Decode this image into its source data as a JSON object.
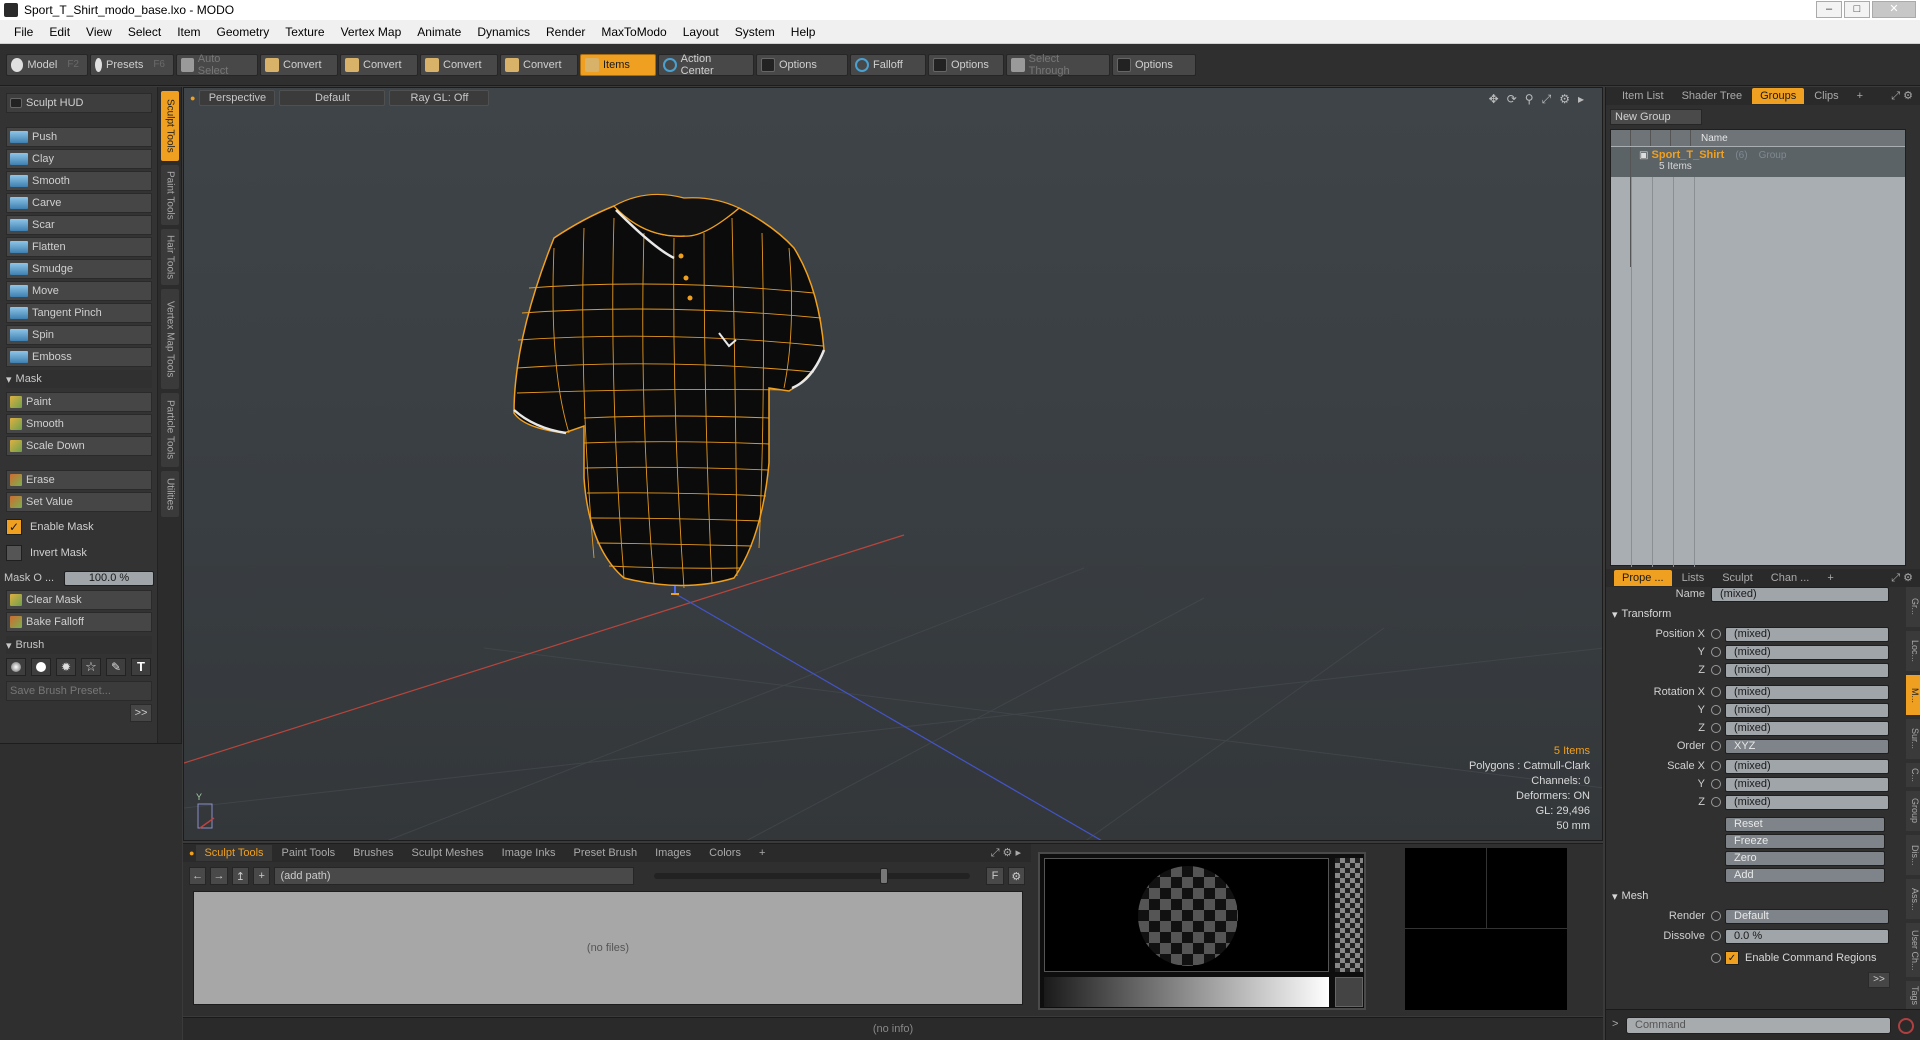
{
  "window": {
    "title": "Sport_T_Shirt_modo_base.lxo - MODO"
  },
  "menubar": [
    "File",
    "Edit",
    "View",
    "Select",
    "Item",
    "Geometry",
    "Texture",
    "Vertex Map",
    "Animate",
    "Dynamics",
    "Render",
    "MaxToModo",
    "Layout",
    "System",
    "Help"
  ],
  "toolbar": {
    "model": "Model",
    "model_key": "F2",
    "presets": "Presets",
    "presets_key": "F6",
    "auto_select": "Auto Select",
    "convert1": "Convert",
    "convert2": "Convert",
    "convert3": "Convert",
    "convert4": "Convert",
    "items": "Items",
    "action_center": "Action Center",
    "options1": "Options",
    "falloff": "Falloff",
    "options2": "Options",
    "select_through": "Select Through",
    "options3": "Options"
  },
  "left_panel": {
    "vtabs": [
      "Sculpt Tools",
      "Paint Tools",
      "Hair Tools",
      "Vertex Map Tools",
      "Particle Tools",
      "Utilities"
    ],
    "hud": "Sculpt HUD",
    "tools": [
      "Push",
      "Clay",
      "Smooth",
      "Carve",
      "Scar",
      "Flatten",
      "Smudge",
      "Move",
      "Tangent Pinch",
      "Spin",
      "Emboss"
    ],
    "mask_header": "Mask",
    "mask_tools": [
      "Paint",
      "Smooth",
      "Scale Down"
    ],
    "erase": "Erase",
    "set_value": "Set Value",
    "enable_mask": "Enable Mask",
    "invert_mask": "Invert Mask",
    "mask_opacity_label": "Mask O ...",
    "mask_opacity_value": "100.0 %",
    "clear_mask": "Clear Mask",
    "bake_falloff": "Bake Falloff",
    "brush_header": "Brush",
    "brush_glyph_text": "T",
    "save_brush_preset": "Save Brush Preset...",
    "more": ">>"
  },
  "viewport": {
    "view": "Perspective",
    "style": "Default",
    "raygl": "Ray GL: Off",
    "info": {
      "items": "5 Items",
      "polygons": "Polygons : Catmull-Clark",
      "channels": "Channels: 0",
      "deformers": "Deformers: ON",
      "gl": "GL: 29,496",
      "scale": "50 mm"
    },
    "axis_label": "Y"
  },
  "bottom_dock": {
    "tabs": [
      "Sculpt Tools",
      "Paint Tools",
      "Brushes",
      "Sculpt Meshes",
      "Image Inks",
      "Preset Brush",
      "Images",
      "Colors",
      "+"
    ],
    "path": "(add path)",
    "path_btn_f": "F",
    "files_placeholder": "(no files)"
  },
  "statusbar": {
    "text": "(no info)"
  },
  "right_panel": {
    "top_tabs": [
      "Item List",
      "Shader Tree",
      "Groups",
      "Clips",
      "+"
    ],
    "new_group": "New Group",
    "table_header": "Name",
    "group": {
      "name": "Sport_T_Shirt",
      "count_tag": "(6)",
      "type": "Group",
      "items": "5 Items"
    },
    "prop_tabs": [
      "Prope ...",
      "Lists",
      "Sculpt",
      "Chan ...",
      "+"
    ],
    "props": {
      "name_label": "Name",
      "name_value": "(mixed)",
      "transform_header": "Transform",
      "position_x_label": "Position X",
      "position_x": "(mixed)",
      "position_y_label": "Y",
      "position_y": "(mixed)",
      "position_z_label": "Z",
      "position_z": "(mixed)",
      "rotation_x_label": "Rotation X",
      "rotation_x": "(mixed)",
      "rotation_y_label": "Y",
      "rotation_y": "(mixed)",
      "rotation_z_label": "Z",
      "rotation_z": "(mixed)",
      "order_label": "Order",
      "order_value": "XYZ",
      "scale_x_label": "Scale X",
      "scale_x": "(mixed)",
      "scale_y_label": "Y",
      "scale_y": "(mixed)",
      "scale_z_label": "Z",
      "scale_z": "(mixed)",
      "reset": "Reset",
      "freeze": "Freeze",
      "zero": "Zero",
      "add": "Add",
      "mesh_header": "Mesh",
      "render_label": "Render",
      "render_value": "Default",
      "dissolve_label": "Dissolve",
      "dissolve_value": "0.0 %",
      "enable_cmd_regions": "Enable Command Regions",
      "more": ">>"
    },
    "right_vtabs": [
      "Gr...",
      "Loc...",
      "M...",
      "Sur...",
      "C...",
      "Group",
      "Dis...",
      "Ass...",
      "User Ch...",
      "Tags"
    ],
    "command_placeholder": "Command"
  },
  "colors": {
    "accent": "#f0a020",
    "wire": "#f0a020"
  }
}
